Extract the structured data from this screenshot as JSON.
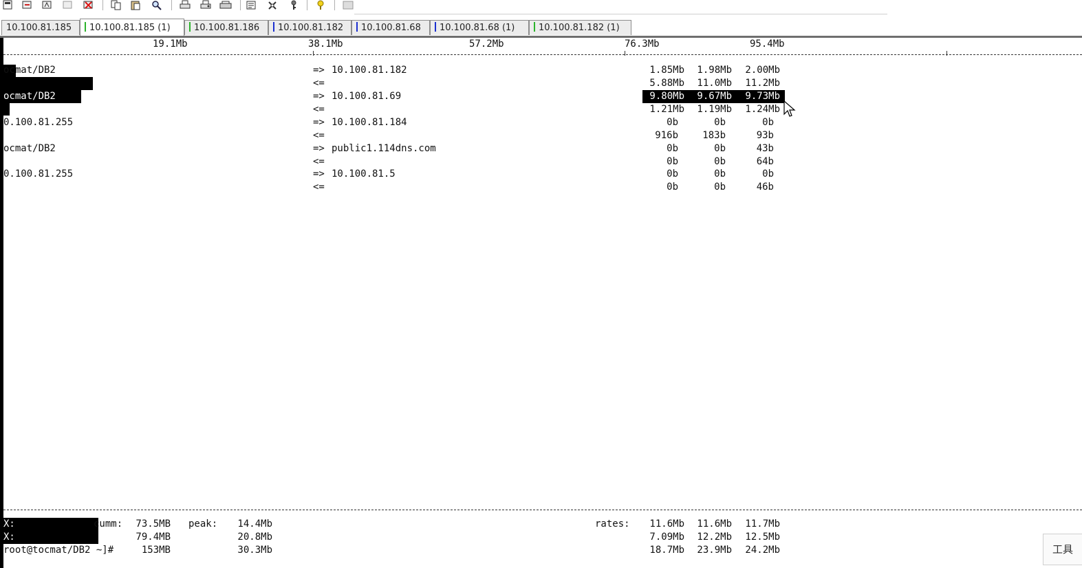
{
  "toolbar": {
    "icons": [
      "new-session-icon",
      "connect-icon",
      "reconnect-icon",
      "disconnect-icon",
      "close-session-icon",
      "copy-icon",
      "paste-icon",
      "find-icon",
      "print-icon",
      "print-setup-icon",
      "printer-icon",
      "properties-icon",
      "tools-icon",
      "key-icon",
      "help-icon",
      "screen-icon"
    ]
  },
  "tabs": [
    {
      "label": "10.100.81.185",
      "mark": ""
    },
    {
      "label": "10.100.81.185 (1)",
      "mark": "#2bb32b"
    },
    {
      "label": "10.100.81.186",
      "mark": "#2bb32b"
    },
    {
      "label": "10.100.81.182",
      "mark": "#1b2fd0"
    },
    {
      "label": "10.100.81.68",
      "mark": "#1b2fd0"
    },
    {
      "label": "10.100.81.68 (1)",
      "mark": "#1b2fd0"
    },
    {
      "label": "10.100.81.182 (1)",
      "mark": "#2bb32b"
    }
  ],
  "scale": [
    "19.1Mb",
    "38.1Mb",
    "57.2Mb",
    "76.3Mb",
    "95.4Mb"
  ],
  "connections": [
    {
      "source": "ocmat/DB2",
      "dest": "10.100.81.182",
      "out": [
        "1.85Mb",
        "1.98Mb",
        "2.00Mb"
      ],
      "in": [
        "5.88Mb",
        "11.0Mb",
        "11.2Mb"
      ]
    },
    {
      "source": "ocmat/DB2",
      "dest": "10.100.81.69",
      "out": [
        "9.80Mb",
        "9.67Mb",
        "9.73Mb"
      ],
      "in": [
        "1.21Mb",
        "1.19Mb",
        "1.24Mb"
      ]
    },
    {
      "source": "0.100.81.255",
      "dest": "10.100.81.184",
      "out": [
        "0b",
        "0b",
        "0b"
      ],
      "in": [
        "916b",
        "183b",
        "93b"
      ]
    },
    {
      "source": "ocmat/DB2",
      "dest": "public1.114dns.com",
      "out": [
        "0b",
        "0b",
        "43b"
      ],
      "in": [
        "0b",
        "0b",
        "64b"
      ]
    },
    {
      "source": "0.100.81.255",
      "dest": "10.100.81.5",
      "out": [
        "0b",
        "0b",
        "0b"
      ],
      "in": [
        "0b",
        "0b",
        "46b"
      ]
    }
  ],
  "arrows": {
    "out": "=>",
    "in": "<="
  },
  "footer": {
    "tx_label": "X:",
    "rx_label": "X:",
    "cumm_label": "cumm:",
    "peak_label": "peak:",
    "rates_label": "rates:",
    "tx_cumm": "73.5MB",
    "tx_peak": "14.4Mb",
    "tx_rates": [
      "11.6Mb",
      "11.6Mb",
      "11.7Mb"
    ],
    "rx_cumm": "79.4MB",
    "rx_peak": "20.8Mb",
    "rx_rates": [
      "7.09Mb",
      "12.2Mb",
      "12.5Mb"
    ],
    "total_prompt": "root@tocmat/DB2 ~]#",
    "total_cumm": "153MB",
    "total_peak": "30.3Mb",
    "total_rates": [
      "18.7Mb",
      "23.9Mb",
      "24.2Mb"
    ]
  },
  "side_button": "工具"
}
